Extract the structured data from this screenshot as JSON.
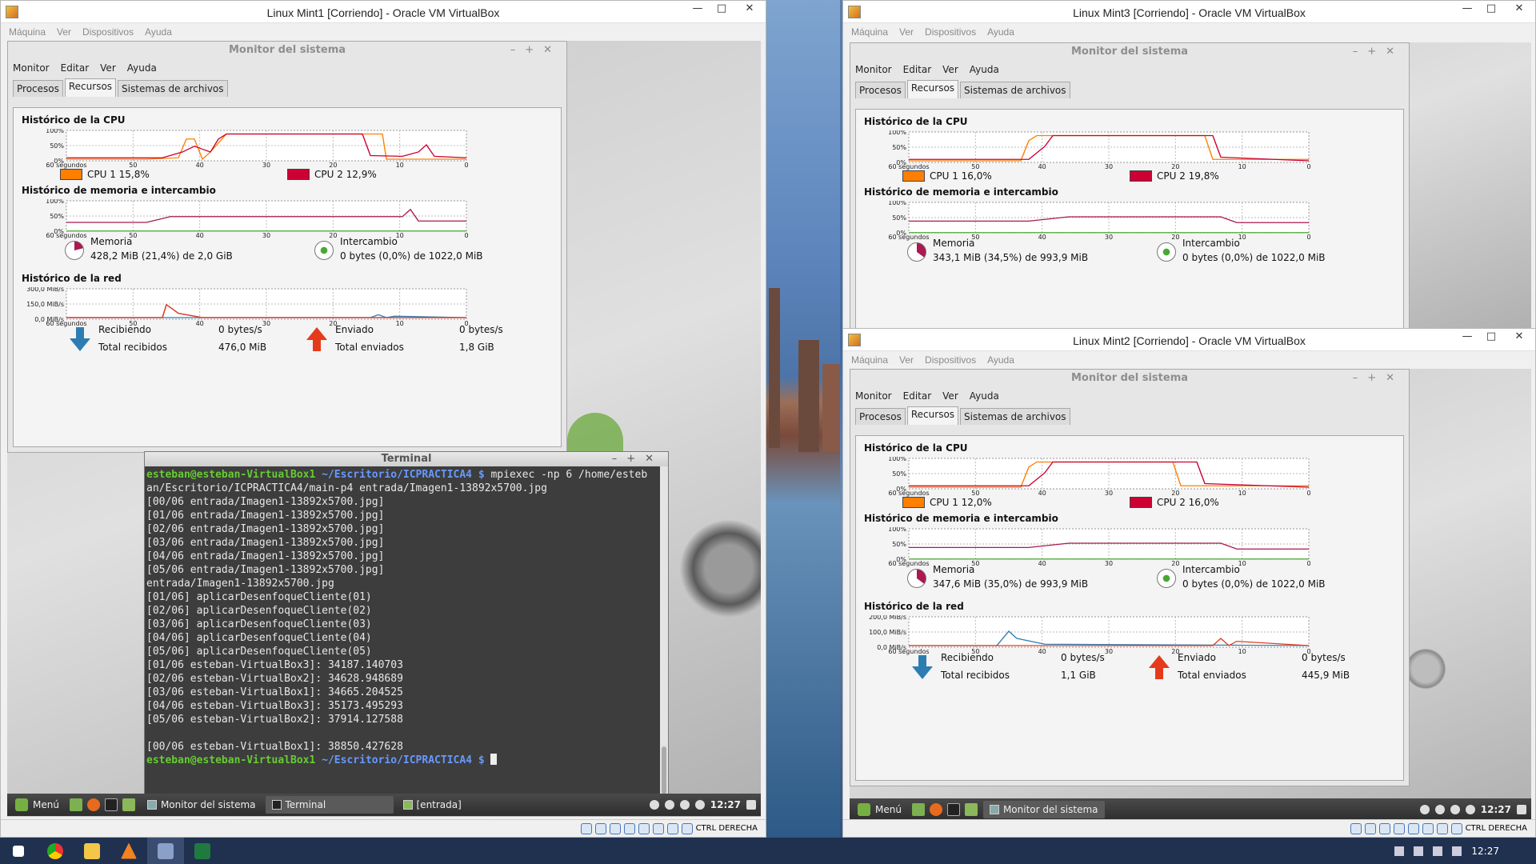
{
  "windows": {
    "mint1": {
      "title": "Linux Mint1 [Corriendo] - Oracle VM VirtualBox"
    },
    "mint3": {
      "title": "Linux Mint3 [Corriendo] - Oracle VM VirtualBox"
    },
    "mint2": {
      "title": "Linux Mint2 [Corriendo] - Oracle VM VirtualBox"
    }
  },
  "vbox_menu": [
    "Máquina",
    "Ver",
    "Dispositivos",
    "Ayuda"
  ],
  "vbox_status": {
    "hostkey": "CTRL DERECHA"
  },
  "sysmon": {
    "title": "Monitor del sistema",
    "menu": [
      "Monitor",
      "Editar",
      "Ver",
      "Ayuda"
    ],
    "tabs": [
      "Procesos",
      "Recursos",
      "Sistemas de archivos"
    ],
    "cpu_heading": "Histórico de la CPU",
    "mem_heading": "Histórico de memoria e intercambio",
    "net_heading": "Histórico de la red",
    "x_ticks": [
      "60 segundos",
      "50",
      "40",
      "30",
      "20",
      "10",
      "0"
    ],
    "pct_ticks": [
      "100%",
      "50%",
      "0%"
    ],
    "mem_label": "Memoria",
    "swap_label": "Intercambio",
    "recv_label": "Recibiendo",
    "total_recv_label": "Total recibidos",
    "sent_label": "Enviado",
    "total_sent_label": "Total enviados",
    "colors": {
      "cpu1": "#ff7f00",
      "cpu2": "#cc0033",
      "mem": "#ab1852",
      "swap": "#49a835",
      "recv": "#2d7db3",
      "sent": "#844798"
    }
  },
  "mint1_sysmon": {
    "cpu1": "CPU 1  15,8%",
    "cpu2": "CPU 2  12,9%",
    "mem_value": "428,2 MiB (21,4%) de 2,0 GiB",
    "swap_value": "0 bytes (0,0%) de 1022,0 MiB",
    "net_ticks": [
      "300,0 MiB/s",
      "150,0 MiB/s",
      "0,0 MiB/s"
    ],
    "recv_rate": "0 bytes/s",
    "recv_total": "476,0 MiB",
    "sent_rate": "0 bytes/s",
    "sent_total": "1,8 GiB"
  },
  "mint3_sysmon": {
    "cpu1": "CPU 1  16,0%",
    "cpu2": "CPU 2  19,8%",
    "mem_value": "343,1 MiB (34,5%) de 993,9 MiB",
    "swap_value": "0 bytes (0,0%) de 1022,0 MiB"
  },
  "mint2_sysmon": {
    "cpu1": "CPU 1  12,0%",
    "cpu2": "CPU 2  16,0%",
    "mem_value": "347,6 MiB (35,0%) de 993,9 MiB",
    "swap_value": "0 bytes (0,0%) de 1022,0 MiB",
    "net_ticks": [
      "200,0 MiB/s",
      "100,0 MiB/s",
      "0,0 MiB/s"
    ],
    "recv_rate": "0 bytes/s",
    "recv_total": "1,1 GiB",
    "sent_rate": "0 bytes/s",
    "sent_total": "445,9 MiB"
  },
  "terminal": {
    "title": "Terminal",
    "prompt_user": "esteban@esteban-VirtualBox1",
    "prompt_dir": "~/Escritorio/ICPRACTICA4 $",
    "command": " mpiexec -np 6 /home/esteb",
    "lines": [
      "an/Escritorio/ICPRACTICA4/main-p4 entrada/Imagen1-13892x5700.jpg",
      "[00/06 entrada/Imagen1-13892x5700.jpg]",
      "[01/06 entrada/Imagen1-13892x5700.jpg]",
      "[02/06 entrada/Imagen1-13892x5700.jpg]",
      "[03/06 entrada/Imagen1-13892x5700.jpg]",
      "[04/06 entrada/Imagen1-13892x5700.jpg]",
      "[05/06 entrada/Imagen1-13892x5700.jpg]",
      "entrada/Imagen1-13892x5700.jpg",
      "[01/06] aplicarDesenfoqueCliente(01)",
      "[02/06] aplicarDesenfoqueCliente(02)",
      "[03/06] aplicarDesenfoqueCliente(03)",
      "[04/06] aplicarDesenfoqueCliente(04)",
      "[05/06] aplicarDesenfoqueCliente(05)",
      "[01/06 esteban-VirtualBox3]: 34187.140703",
      "[02/06 esteban-VirtualBox2]: 34628.948689",
      "[03/06 esteban-VirtualBox1]: 34665.204525",
      "[04/06 esteban-VirtualBox3]: 35173.495293",
      "[05/06 esteban-VirtualBox2]: 37914.127588",
      "",
      "[00/06 esteban-VirtualBox1]: 38850.427628"
    ]
  },
  "mint_panel": {
    "menu_label": "Menú",
    "clock": "12:27",
    "tasks_left": [
      "Monitor del sistema",
      "Terminal",
      "[entrada]"
    ],
    "tasks_right": [
      "Monitor del sistema"
    ]
  },
  "host_taskbar": {
    "clock": "12:27"
  }
}
